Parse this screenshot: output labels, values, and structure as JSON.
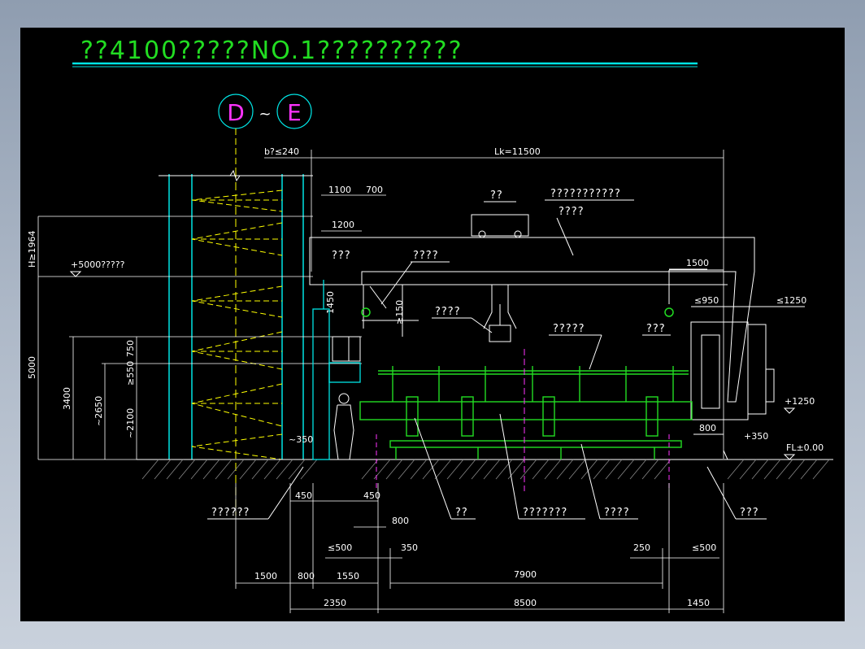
{
  "title": "??4100?????NO.1??????????",
  "axis": {
    "left": "D",
    "sep": "~",
    "right": "E"
  },
  "dims": {
    "b": "b?≤240",
    "lk": "Lk=11500",
    "d1100": "1100",
    "d700": "700",
    "d1200": "1200",
    "h1964": "H≥1964",
    "d1450": "1450",
    "d150": "≥150",
    "d750": "750",
    "d550": "≥550",
    "d5000": "5000",
    "d3400": "3400",
    "d2650": "~2650",
    "d2100": "~2100",
    "d350s": "~350",
    "d1500r": "1500",
    "d950": "≤950",
    "d1250": "≤1250",
    "d800r": "800",
    "d450a": "450",
    "d450b": "450",
    "d800": "800",
    "d500a": "≤500",
    "d350": "350",
    "d250": "250",
    "d500b": "≤500",
    "d1500": "1500",
    "d800b": "800",
    "d1550": "1550",
    "d7900": "7900",
    "d2350": "2350",
    "d8500": "8500"
  },
  "levels": {
    "e5000": "+5000?????",
    "e1250": "+1250",
    "e350": "+350",
    "fl": "FL±0.00"
  },
  "labels": {
    "car": "??",
    "crane": "???????????",
    "crane2": "????",
    "hook1": "???",
    "frame": "????",
    "grip": "????",
    "beam": "?????",
    "hook2": "???",
    "bot1": "??????",
    "bot2": "??",
    "bot3": "???????",
    "bot4": "????",
    "bot5": "???"
  }
}
